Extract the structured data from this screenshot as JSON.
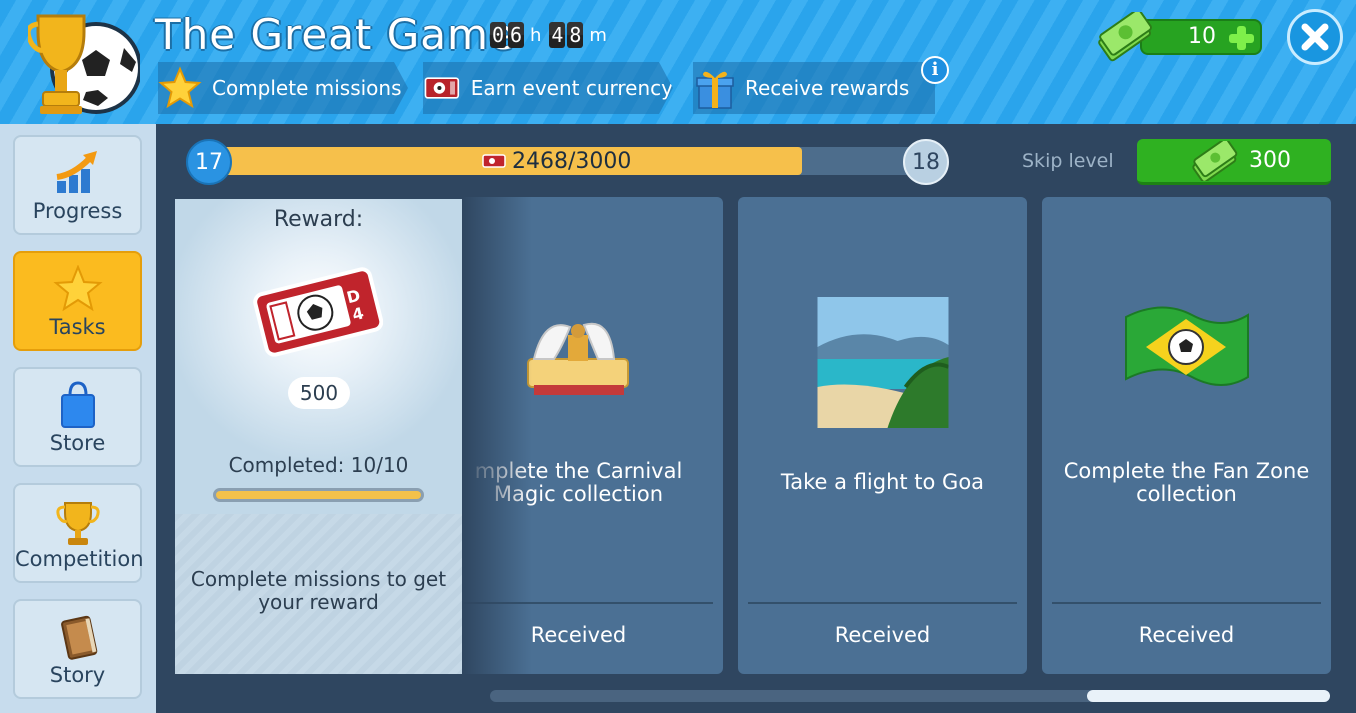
{
  "header": {
    "title": "The Great Game",
    "timer": {
      "hours": [
        "0",
        "6"
      ],
      "hours_unit": "h",
      "minutes": [
        "4",
        "8"
      ],
      "minutes_unit": "m"
    },
    "steps": [
      {
        "label": "Complete missions",
        "icon": "star-icon"
      },
      {
        "label": "Earn event currency",
        "icon": "ticket-icon"
      },
      {
        "label": "Receive rewards",
        "icon": "gift-icon"
      }
    ],
    "info_label": "i",
    "currency": {
      "value": "10",
      "icon": "cash-icon"
    }
  },
  "sidebar": {
    "items": [
      {
        "label": "Progress",
        "icon": "growth-chart-icon",
        "active": false
      },
      {
        "label": "Tasks",
        "icon": "star-icon",
        "active": true
      },
      {
        "label": "Store",
        "icon": "shopping-bag-icon",
        "active": false
      },
      {
        "label": "Competition",
        "icon": "trophy-icon",
        "active": false
      },
      {
        "label": "Story",
        "icon": "book-icon",
        "active": false
      }
    ]
  },
  "level": {
    "current": "17",
    "next": "18",
    "progress_text": "2468/3000",
    "progress_fraction": 0.8227
  },
  "skip": {
    "label": "Skip level",
    "cost": "300"
  },
  "reward": {
    "title": "Reward:",
    "amount": "500",
    "completed": "Completed: 10/10",
    "completed_fraction": 1.0,
    "description": "Complete missions to get your reward"
  },
  "missions": [
    {
      "title": "mplete the Carnival\nMagic collection",
      "status": "Received",
      "icon": "carnival-float-icon"
    },
    {
      "title": "Take a flight to Goa",
      "status": "Received",
      "icon": "beach-photo-icon"
    },
    {
      "title": "Complete the Fan Zone\ncollection",
      "status": "Received",
      "icon": "brazil-flag-icon"
    }
  ],
  "colors": {
    "header_blue": "#2aa4ec",
    "active_tab": "#fbbb1f",
    "progress_fill": "#f6c04b",
    "card_bg": "#4b7094",
    "skip_green": "#2fb121"
  }
}
